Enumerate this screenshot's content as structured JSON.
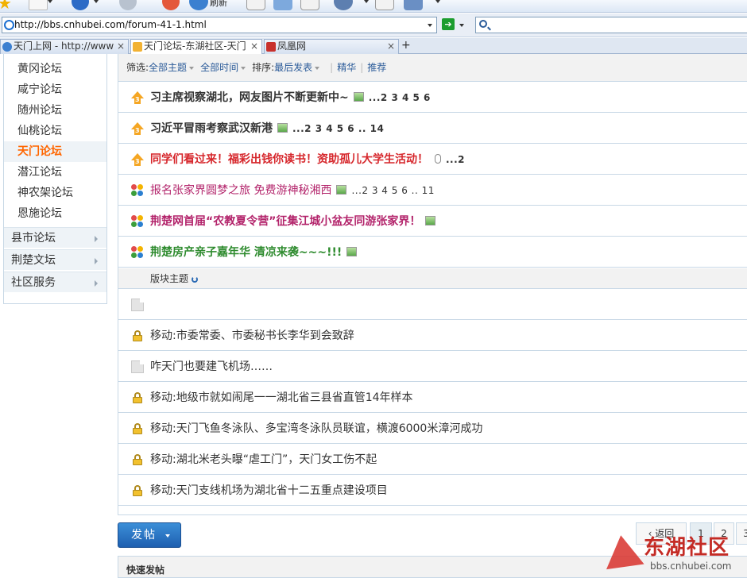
{
  "browser": {
    "toolbar_label": "刷新",
    "address": "http://bbs.cnhubei.com/forum-41-1.html",
    "search_placeholder": "",
    "tabs": [
      {
        "label": "天门上网 - http://www",
        "active": false
      },
      {
        "label": "天门论坛-东湖社区-天门",
        "active": true
      },
      {
        "label": "凤凰网",
        "active": false
      }
    ],
    "tab_close": "×",
    "new_tab": "+"
  },
  "sidebar": {
    "items": [
      {
        "label": "黄冈论坛",
        "active": false
      },
      {
        "label": "咸宁论坛",
        "active": false
      },
      {
        "label": "随州论坛",
        "active": false
      },
      {
        "label": "仙桃论坛",
        "active": false
      },
      {
        "label": "天门论坛",
        "active": true
      },
      {
        "label": "潜江论坛",
        "active": false
      },
      {
        "label": "神农架论坛",
        "active": false
      },
      {
        "label": "恩施论坛",
        "active": false
      }
    ],
    "groups": [
      "县市论坛",
      "荆楚文坛",
      "社区服务"
    ]
  },
  "filter": {
    "label": "筛选:",
    "all_topics": "全部主题",
    "all_time": "全部时间",
    "sort_label": "排序:",
    "sort_value": "最后发表",
    "digest": "精华",
    "recommend": "推荐"
  },
  "threads": [
    {
      "title": "习主席视察湖北，网友图片不断更新中~",
      "color": "#333333",
      "icon": "pin",
      "pages": "...2 3 4 5 6",
      "image": true,
      "attach": false
    },
    {
      "title": "习近平冒雨考察武汉新港",
      "color": "#333333",
      "icon": "pin",
      "pages": "...2 3 4 5 6 .. 14",
      "image": true,
      "attach": false
    },
    {
      "title": "同学们看过来！福彩出钱你读书！资助孤儿大学生活动！",
      "color": "#d6262b",
      "icon": "pin",
      "pages": "...2",
      "image": false,
      "attach": true
    },
    {
      "title": "报名张家界圆梦之旅 免费游神秘湘西",
      "color": "#b3246b",
      "icon": "flower",
      "pages": "...2 3 4 5 6 .. 11",
      "image": true,
      "attach": false
    },
    {
      "title": "荆楚网首届“农教夏令营”征集江城小盆友同游张家界！",
      "color": "#b3246b",
      "icon": "flower",
      "pages": "",
      "image": true,
      "attach": false
    },
    {
      "title": "荆楚房产亲子嘉年华 清凉来袭~~~!!!",
      "color": "#2e8b2e",
      "icon": "flower",
      "pages": "",
      "image": true,
      "attach": false
    }
  ],
  "section_head": "版块主题",
  "topics": [
    {
      "title": "",
      "icon": "doc"
    },
    {
      "title": "移动:市委常委、市委秘书长李华到会致辞",
      "icon": "lock"
    },
    {
      "title": "咋天门也要建飞机场……",
      "icon": "doc"
    },
    {
      "title": "移动:地级市就如闹尾一一湖北省三县省直管14年样本",
      "icon": "lock"
    },
    {
      "title": "移动:天门飞鱼冬泳队、多宝湾冬泳队员联谊，横渡6000米漳河成功",
      "icon": "lock"
    },
    {
      "title": "移动:湖北米老头曝“虐工门”，天门女工伤不起",
      "icon": "lock"
    },
    {
      "title": "移动:天门支线机场为湖北省十二五重点建设项目",
      "icon": "lock"
    }
  ],
  "post_button": "发帖",
  "pager": {
    "back": "返回",
    "pages": [
      "1",
      "2",
      "3"
    ]
  },
  "quick_post": "快速发帖",
  "logo": {
    "brand": "东湖社区",
    "url": "bbs.cnhubei.com"
  }
}
